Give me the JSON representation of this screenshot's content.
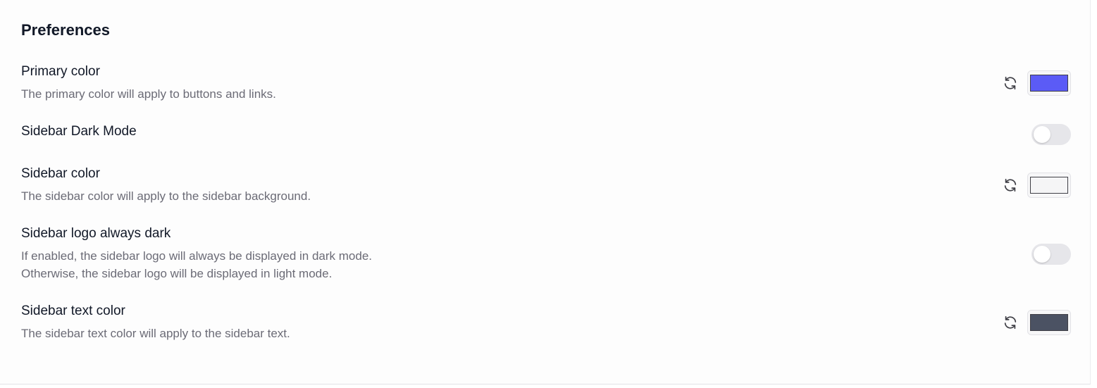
{
  "preferences": {
    "title": "Preferences",
    "primary_color": {
      "label": "Primary color",
      "description": "The primary color will apply to buttons and links.",
      "value": "#5b5bf6"
    },
    "sidebar_dark_mode": {
      "label": "Sidebar Dark Mode",
      "enabled": false
    },
    "sidebar_color": {
      "label": "Sidebar color",
      "description": "The sidebar color will apply to the sidebar background.",
      "value": "#f5f5f6"
    },
    "sidebar_logo_always_dark": {
      "label": "Sidebar logo always dark",
      "description_lines": [
        "If enabled, the sidebar logo will always be displayed in dark mode.",
        "Otherwise, the sidebar logo will be displayed in light mode."
      ],
      "enabled": false
    },
    "sidebar_text_color": {
      "label": "Sidebar text color",
      "description": "The sidebar text color will apply to the sidebar text.",
      "value": "#4b5263"
    }
  },
  "icons": {
    "reset": "refresh-icon"
  }
}
